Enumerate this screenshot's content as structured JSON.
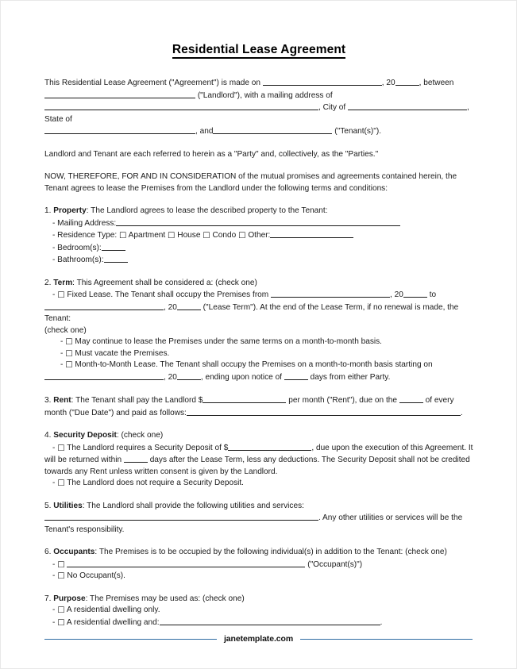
{
  "document": {
    "title": "Residential Lease Agreement",
    "intro": {
      "line1_a": "This Residential Lease Agreement (\"Agreement\") is made on",
      "line1_b": ", 20",
      "line1_c": ", between",
      "line2_a": "(\"Landlord\"), with a mailing address of",
      "line3_a": ", City of",
      "line3_b": ", State of",
      "line4_a": ", and",
      "line4_b": "(\"Tenant(s)\")."
    },
    "parties_clause": "Landlord and Tenant are each referred to herein as a \"Party\" and, collectively, as the \"Parties.\"",
    "consideration_clause": "NOW, THEREFORE, FOR AND IN CONSIDERATION of the mutual promises and agreements contained herein, the Tenant agrees to lease the Premises from the Landlord under the following terms and conditions:",
    "sections": {
      "property": {
        "number": "1.",
        "heading": "Property",
        "intro": ": The Landlord agrees to lease the described property to the Tenant:",
        "mailing_label": "- Mailing Address:",
        "residence_label": "- Residence Type:",
        "opt_apartment": "Apartment",
        "opt_house": "House",
        "opt_condo": "Condo",
        "opt_other": "Other:",
        "bedrooms_label": "- Bedroom(s):",
        "bathrooms_label": "- Bathroom(s):"
      },
      "term": {
        "number": "2.",
        "heading": "Term",
        "intro": ": This Agreement shall be considered a: (check one)",
        "fixed_a": "Fixed Lease. The Tenant shall occupy the Premises from",
        "fixed_b": ", 20",
        "fixed_c": "to",
        "fixed_d": ", 20",
        "fixed_e": "(\"Lease Term\"). At the end of the Lease Term, if no renewal is made, the Tenant:",
        "check_one": "(check one)",
        "opt_continue": "May continue to lease the Premises under the same terms on a month-to-month basis.",
        "opt_vacate": "Must vacate the Premises.",
        "opt_mtm_a": "Month-to-Month Lease. The Tenant shall occupy the Premises on a month-to-month basis starting on",
        "opt_mtm_b": ", 20",
        "opt_mtm_c": ", ending upon notice of",
        "opt_mtm_d": "days from either Party."
      },
      "rent": {
        "number": "3.",
        "heading": "Rent",
        "text_a": ": The Tenant shall pay the Landlord $",
        "text_b": "per month (\"Rent\"), due on the",
        "text_c": "of every month (\"Due Date\") and paid as follows:",
        "text_d": "."
      },
      "security_deposit": {
        "number": "4.",
        "heading": "Security Deposit",
        "intro": ": (check one)",
        "opt_requires_a": "The Landlord requires a Security Deposit of $",
        "opt_requires_b": ", due upon the execution of this Agreement. It will be returned within",
        "opt_requires_c": "days after the Lease Term, less any deductions. The Security Deposit shall not be credited towards any Rent unless written consent is given by the Landlord.",
        "opt_not_required": "The Landlord does not require a Security Deposit."
      },
      "utilities": {
        "number": "5.",
        "heading": "Utilities",
        "text_a": ": The Landlord shall provide the following utilities and services:",
        "text_b": ". Any other utilities or services will be the Tenant's responsibility."
      },
      "occupants": {
        "number": "6.",
        "heading": "Occupants",
        "intro": ": The Premises is to be occupied by the following individual(s) in addition to the Tenant: (check one)",
        "opt_blank_suffix": "(\"Occupant(s)\")",
        "opt_none": "No Occupant(s)."
      },
      "purpose": {
        "number": "7.",
        "heading": "Purpose",
        "intro": ": The Premises may be used as: (check one)",
        "opt_dwelling_only": "A residential dwelling only.",
        "opt_dwelling_and": "A residential dwelling and:",
        "opt_dwelling_and_suffix": "."
      }
    },
    "footer": {
      "brand": "janetemplate.com",
      "rule_color": "#2f6ca3"
    },
    "checkbox_glyph": "☐",
    "bullet": "-"
  }
}
